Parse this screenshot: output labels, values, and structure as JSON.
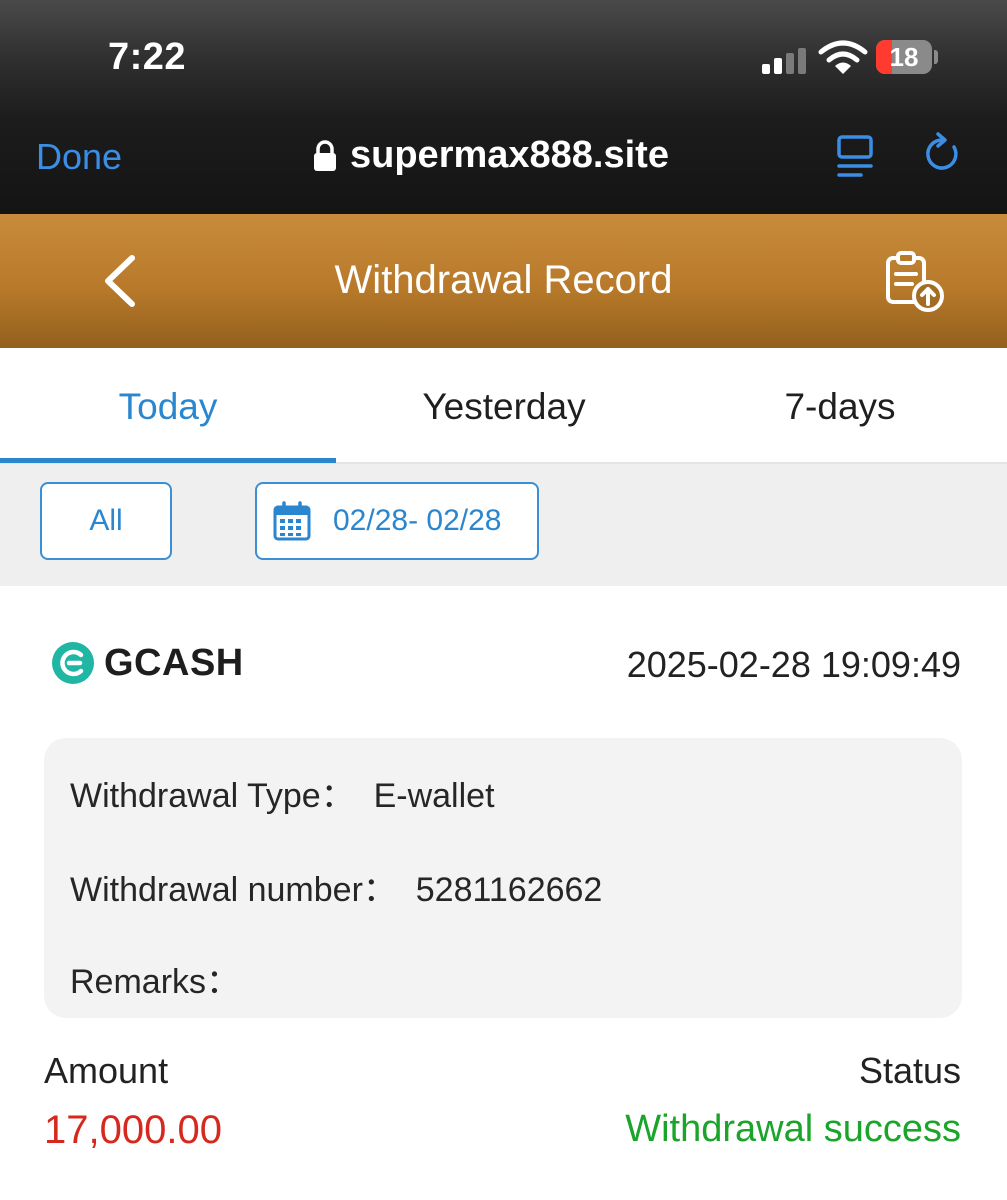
{
  "status_bar": {
    "time": "7:22",
    "battery": "18"
  },
  "browser": {
    "done_label": "Done",
    "url": "supermax888.site"
  },
  "header": {
    "title": "Withdrawal Record"
  },
  "tabs": [
    {
      "label": "Today",
      "active": true
    },
    {
      "label": "Yesterday",
      "active": false
    },
    {
      "label": "7-days",
      "active": false
    }
  ],
  "filters": {
    "all_label": "All",
    "date_range": "02/28- 02/28"
  },
  "record": {
    "provider": "GCASH",
    "datetime": "2025-02-28 19:09:49",
    "type_line": "Withdrawal Type：  E-wallet",
    "number_line": "Withdrawal number：  5281162662",
    "remarks_line": "Remarks：",
    "amount_label": "Amount",
    "amount_value": "17,000.00",
    "status_label": "Status",
    "status_value": "Withdrawal success"
  },
  "colors": {
    "accent_blue": "#2a86cf",
    "header_brown": "#b87a2a",
    "amount_red": "#d6281d",
    "success_green": "#1aa52a",
    "gcash_teal": "#1fb6a3"
  },
  "icons": [
    "lock-icon",
    "reader-icon",
    "reload-icon",
    "back-chevron-icon",
    "export-record-icon",
    "calendar-icon",
    "gcash-logo-icon"
  ]
}
